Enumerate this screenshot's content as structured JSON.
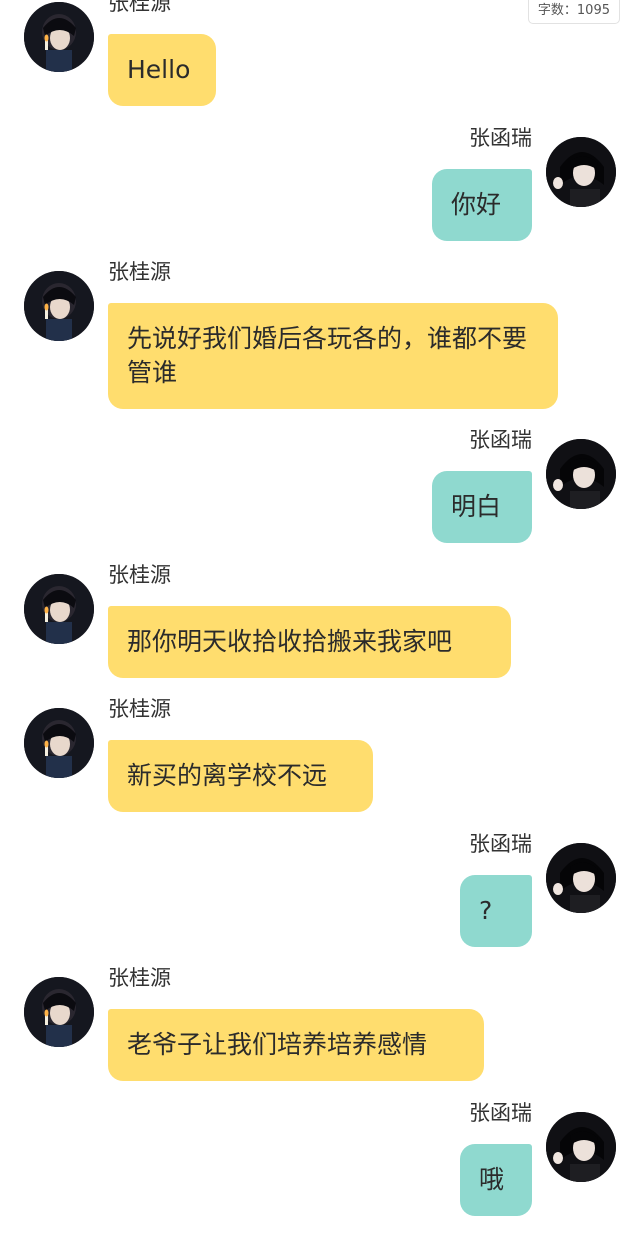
{
  "header": {
    "word_count_label": "字数：1095"
  },
  "colors": {
    "left_bubble": "#ffdd6e",
    "right_bubble": "#8fd9cf",
    "background": "#ffffff"
  },
  "messages": [
    {
      "side": "left",
      "sender": "张桂源",
      "text": "Hello"
    },
    {
      "side": "right",
      "sender": "张函瑞",
      "text": "你好"
    },
    {
      "side": "left",
      "sender": "张桂源",
      "text": "先说好我们婚后各玩各的，谁都不要管谁"
    },
    {
      "side": "right",
      "sender": "张函瑞",
      "text": "明白"
    },
    {
      "side": "left",
      "sender": "张桂源",
      "text": "那你明天收拾收拾搬来我家吧"
    },
    {
      "side": "left",
      "sender": "张桂源",
      "text": "新买的离学校不远"
    },
    {
      "side": "right",
      "sender": "张函瑞",
      "text": "?"
    },
    {
      "side": "left",
      "sender": "张桂源",
      "text": "老爷子让我们培养培养感情"
    },
    {
      "side": "right",
      "sender": "张函瑞",
      "text": "哦"
    }
  ]
}
